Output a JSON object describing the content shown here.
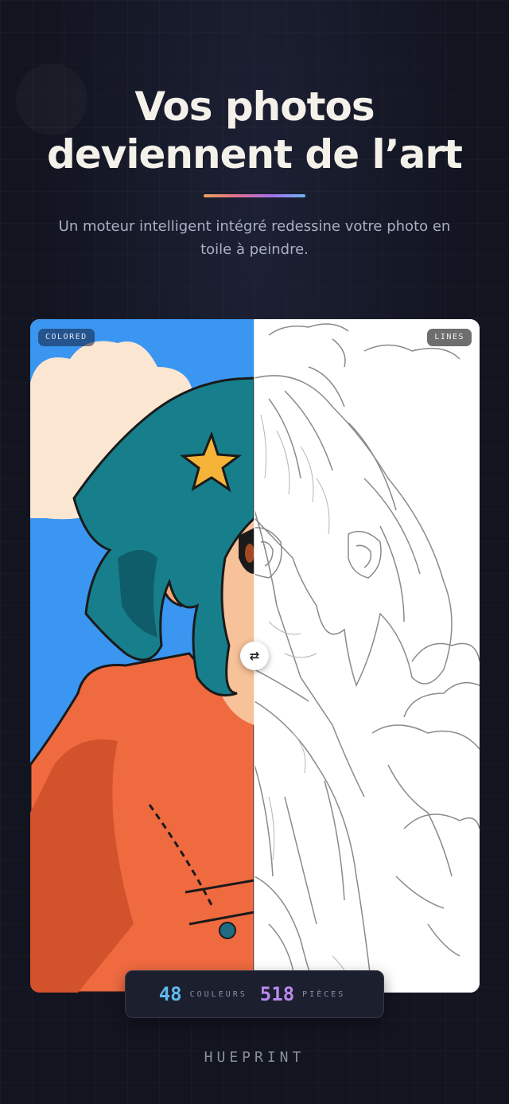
{
  "hero": {
    "title_line1": "Vos photos",
    "title_line2": "deviennent de l’art",
    "subtitle": "Un moteur intelligent intégré redessine votre photo en toile à peindre."
  },
  "comparison": {
    "left_tag": "COLORED",
    "right_tag": "LINES",
    "handle_icon": "swap-horizontal-icon",
    "handle_glyph": "⇄",
    "split_position": 0.5
  },
  "stats": {
    "colors_value": "48",
    "colors_label": "COULEURS",
    "pieces_value": "518",
    "pieces_label": "PIÈCES"
  },
  "brand": {
    "name": "HUEPRINT"
  },
  "colors": {
    "background": "#121420",
    "sky": "#3a96f0",
    "hair": "#177f8c",
    "jacket": "#f06a40",
    "skin": "#f7c199",
    "star": "#f5b338",
    "colors_accent": "#5fb9f0",
    "pieces_accent": "#b98af2"
  }
}
